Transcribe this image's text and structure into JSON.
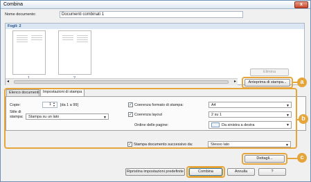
{
  "window": {
    "title": "Combina",
    "close_label": "x"
  },
  "document": {
    "name_label": "Nome documento:",
    "name_value": "Documenti combinati 1"
  },
  "preview": {
    "sheets_label": "Fogli: 2",
    "pages": [
      {
        "number": "1"
      },
      {
        "number": "2"
      }
    ],
    "delete_label": "Elimina",
    "print_preview_label": "Anteprima di stampa..."
  },
  "tabs": [
    {
      "label": "Elenco documenti",
      "active": false
    },
    {
      "label": "Impostazioni di stampa",
      "active": true
    }
  ],
  "settings": {
    "copies_label": "Copie:",
    "copies_value": "1",
    "copies_range": "[da 1 a 99]",
    "print_style_label_1": "Stile di",
    "print_style_label_2": "stampa:",
    "print_style_value": "Stampa su un lato",
    "paper_size_label": "Coerenza formato di stampa:",
    "paper_size_value": "A4",
    "layout_label": "Coerenza layout",
    "layout_value": "2 su 1",
    "page_order_label": "Ordine delle pagine:",
    "page_order_value": "Da sinistra a destra",
    "next_doc_label": "Stampa documento successivo da:",
    "next_doc_value": "Stesso lato"
  },
  "buttons": {
    "details": "Dettagli...",
    "restore_defaults": "Ripristina impostazioni predefinite",
    "combine": "Combina",
    "cancel": "Annulla",
    "help": "?"
  },
  "callouts": {
    "a": "a",
    "b": "b",
    "c": "c"
  },
  "colors": {
    "accent": "#e6a53a",
    "selection": "#2b5c8a"
  }
}
